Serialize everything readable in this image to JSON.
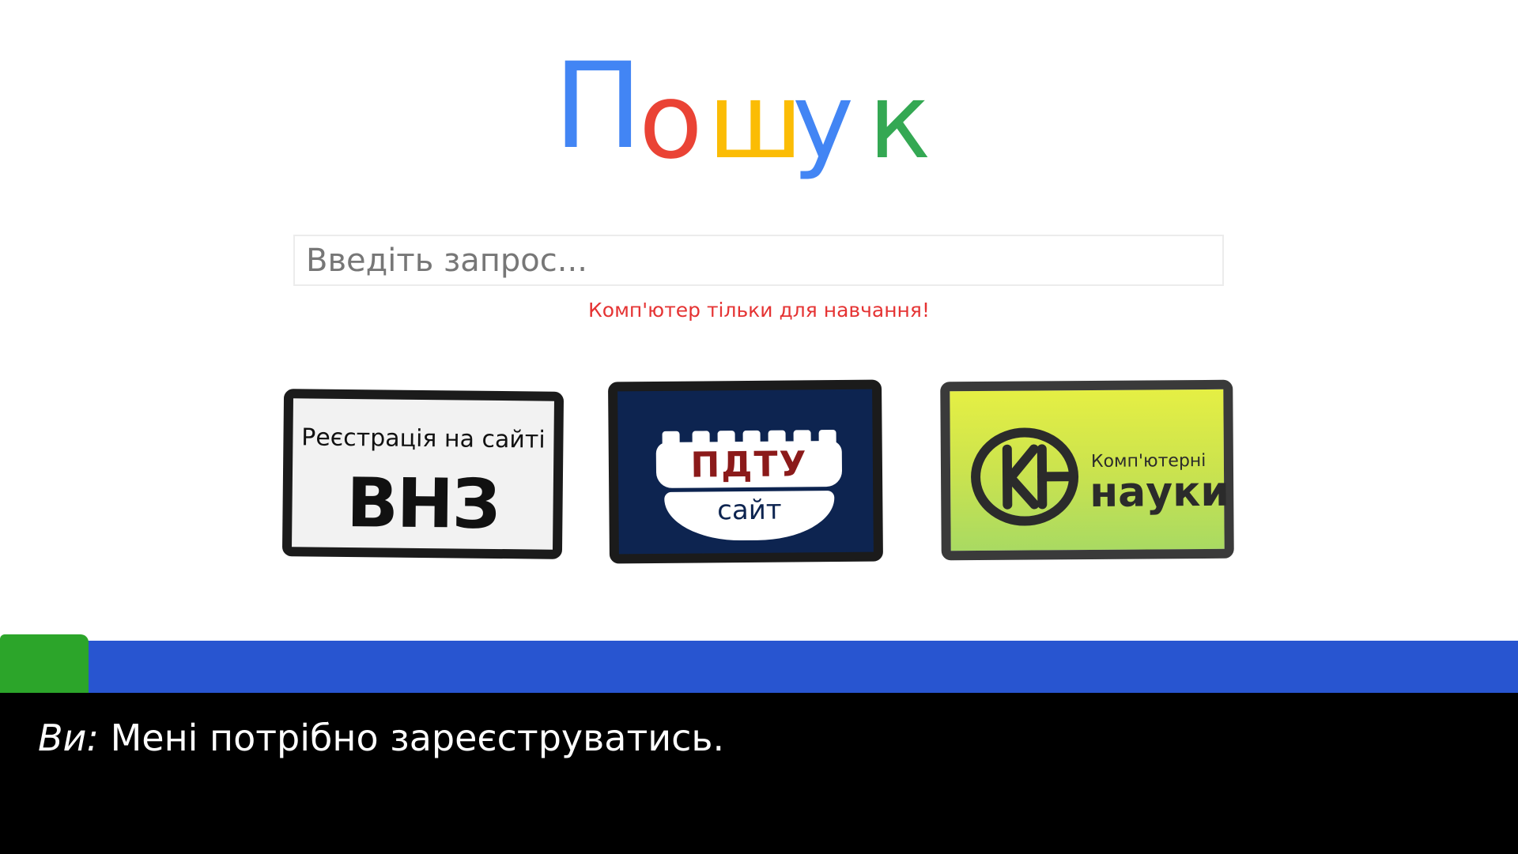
{
  "logo": {
    "text": "Пошук",
    "letters": [
      {
        "char": "П",
        "color": "#4285f4"
      },
      {
        "char": "о",
        "color": "#ea4335"
      },
      {
        "char": "ш",
        "color": "#fbbc05"
      },
      {
        "char": "у",
        "color": "#4285f4"
      },
      {
        "char": "к",
        "color": "#34a853"
      }
    ]
  },
  "search": {
    "placeholder": "Введіть запрос...",
    "value": ""
  },
  "warning": "Комп'ютер тільки для навчання!",
  "cards": {
    "vnz": {
      "small": "Реєстрація на сайті",
      "big": "ВНЗ"
    },
    "pdtu": {
      "top": "ПДТУ",
      "bottom": "сайт"
    },
    "kn": {
      "logo_icon": "kn-logo-icon",
      "small": "Комп'ютерні",
      "big": "науки"
    }
  },
  "dialog": {
    "speaker": "Ви:",
    "text": "Мені потрібно зареєструватись."
  },
  "colors": {
    "warning": "#e53333",
    "blue_bar": "#2855d0",
    "green_tab": "#2ca52a",
    "dialog_bg": "#000000",
    "pdtu_bg": "#0d2450",
    "pdtu_text": "#8b1a1a"
  }
}
